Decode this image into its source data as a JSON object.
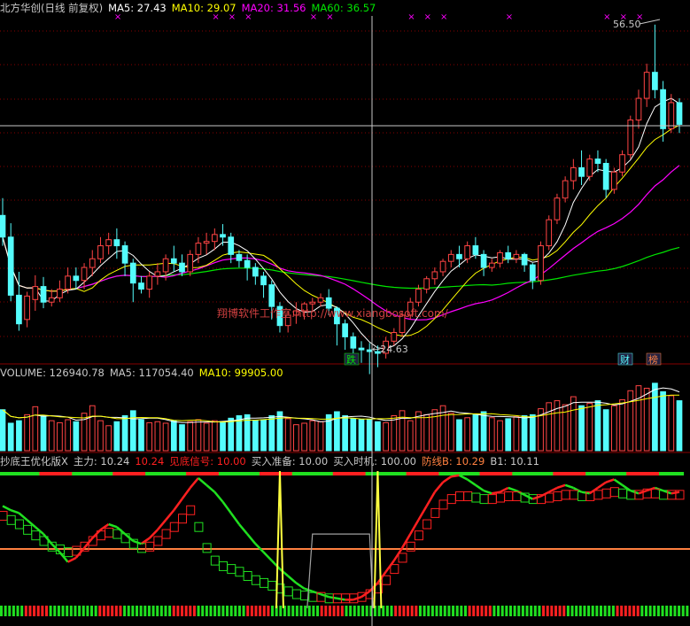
{
  "colors": {
    "bg": "#000000",
    "up": "#ff4444",
    "down": "#54fcfc",
    "ma5": "#ffffff",
    "ma10": "#ffff00",
    "ma20": "#ff00ff",
    "ma60": "#00e600",
    "grid": "#880000",
    "cross": "#c8c8c8",
    "label": "#c8c8c8",
    "ind_red": "#ff2020",
    "ind_green": "#20e020",
    "ind_yellow": "#ffff40",
    "ind_orange": "#ff8040",
    "ind_white": "#c8c8c8",
    "ind_gray": "#a0a0a0"
  },
  "main": {
    "title": "北方华创(日线 前复权)",
    "legend": [
      {
        "label": "MA5: 27.43",
        "color": "#ffffff"
      },
      {
        "label": "MA10: 29.07",
        "color": "#ffff00"
      },
      {
        "label": "MA20: 31.56",
        "color": "#ff00ff"
      },
      {
        "label": "MA60: 36.57",
        "color": "#00e600"
      }
    ],
    "high_label": "56.50",
    "low_label": "24.63",
    "watermark": "翔博软件工作室:http://www.xiangbosoft.com/",
    "badges": [
      {
        "text": "跌",
        "color": "#00e600"
      },
      {
        "text": "财",
        "color": "#54fcfc"
      },
      {
        "text": "榜",
        "color": "#ff8040"
      }
    ],
    "xmarks_note": "magenta x markers along top"
  },
  "volume": {
    "legend": [
      {
        "label": "VOLUME: 126940.78",
        "color": "#c8c8c8"
      },
      {
        "label": "MA5: 117054.40",
        "color": "#c8c8c8"
      },
      {
        "label": "MA10: 99905.00",
        "color": "#ffff00"
      }
    ]
  },
  "indicator": {
    "legend": [
      {
        "label": "抄底王优化版X",
        "color": "#c8c8c8"
      },
      {
        "label": "主力: 10.24",
        "color": "#c8c8c8"
      },
      {
        "label": "10.24",
        "color": "#ff2020"
      },
      {
        "label": "见底信号: 10.00",
        "color": "#ff2020"
      },
      {
        "label": "买入准备: 10.00",
        "color": "#c8c8c8"
      },
      {
        "label": "买入时机: 100.00",
        "color": "#c8c8c8"
      },
      {
        "label": "防线B: 10.29",
        "color": "#ff8040"
      },
      {
        "label": "B1: 10.11",
        "color": "#c8c8c8"
      }
    ]
  },
  "chart_data": {
    "type": "candlestick",
    "title": "北方华创(日线 前复权)",
    "price_range": [
      19.5,
      58.5
    ],
    "candles": [
      [
        35.5,
        37.5,
        33.0,
        32.0
      ],
      [
        33.0,
        34.6,
        26.3,
        25.6
      ],
      [
        26.3,
        29.0,
        23.0,
        22.2
      ],
      [
        23.5,
        26.7,
        26.2,
        22.6
      ],
      [
        25.8,
        28.6,
        27.3,
        24.5
      ],
      [
        27.3,
        28.4,
        25.5,
        24.8
      ],
      [
        25.5,
        27.0,
        26.0,
        25.0
      ],
      [
        26.0,
        28.0,
        27.0,
        25.5
      ],
      [
        27.0,
        29.5,
        28.5,
        26.5
      ],
      [
        28.5,
        29.5,
        28.0,
        27.0
      ],
      [
        28.0,
        30.0,
        29.5,
        27.0
      ],
      [
        29.5,
        31.5,
        30.5,
        28.5
      ],
      [
        30.5,
        33.0,
        32.0,
        30.0
      ],
      [
        32.0,
        33.5,
        32.7,
        31.0
      ],
      [
        32.7,
        34.0,
        32.0,
        30.5
      ],
      [
        32.0,
        32.5,
        30.0,
        28.5
      ],
      [
        30.0,
        30.5,
        27.7,
        25.5
      ],
      [
        27.7,
        28.5,
        27.0,
        26.5
      ],
      [
        27.0,
        29.0,
        28.5,
        26.0
      ],
      [
        28.5,
        30.0,
        29.0,
        27.5
      ],
      [
        29.0,
        31.0,
        30.5,
        28.0
      ],
      [
        30.5,
        32.0,
        30.0,
        29.0
      ],
      [
        30.0,
        31.0,
        29.0,
        28.5
      ],
      [
        29.0,
        31.5,
        31.0,
        28.5
      ],
      [
        31.0,
        33.0,
        32.3,
        30.0
      ],
      [
        32.3,
        33.5,
        32.5,
        31.0
      ],
      [
        32.5,
        34.0,
        33.3,
        31.5
      ],
      [
        33.3,
        34.5,
        33.0,
        32.0
      ],
      [
        33.0,
        33.5,
        31.0,
        30.0
      ],
      [
        31.0,
        31.5,
        30.3,
        29.5
      ],
      [
        30.3,
        31.0,
        29.5,
        28.0
      ],
      [
        29.5,
        30.0,
        28.5,
        27.5
      ],
      [
        28.5,
        29.0,
        27.5,
        26.0
      ],
      [
        27.5,
        28.0,
        25.0,
        23.5
      ],
      [
        25.0,
        25.5,
        22.8,
        22.0
      ],
      [
        22.8,
        24.5,
        24.0,
        22.0
      ],
      [
        24.0,
        25.5,
        24.5,
        23.0
      ],
      [
        24.5,
        25.5,
        25.3,
        23.5
      ],
      [
        25.3,
        26.0,
        25.5,
        24.5
      ],
      [
        25.5,
        26.5,
        26.0,
        25.0
      ],
      [
        26.0,
        27.0,
        24.8,
        24.0
      ],
      [
        24.8,
        25.0,
        23.0,
        20.5
      ],
      [
        23.0,
        23.5,
        21.5,
        20.0
      ],
      [
        21.5,
        22.0,
        20.2,
        19.5
      ],
      [
        20.2,
        21.0,
        20.0,
        18.5
      ],
      [
        20.0,
        20.8,
        19.8,
        17.2
      ],
      [
        19.8,
        20.5,
        19.6,
        18.0
      ],
      [
        19.6,
        21.5,
        21.0,
        19.0
      ],
      [
        21.0,
        22.5,
        22.0,
        20.5
      ],
      [
        22.0,
        24.5,
        24.0,
        21.5
      ],
      [
        24.0,
        26.0,
        25.5,
        23.5
      ],
      [
        25.5,
        27.5,
        27.0,
        25.0
      ],
      [
        27.0,
        28.5,
        28.2,
        26.5
      ],
      [
        28.2,
        29.5,
        29.0,
        27.5
      ],
      [
        29.0,
        30.5,
        30.2,
        28.5
      ],
      [
        30.2,
        31.5,
        31.0,
        29.5
      ],
      [
        31.0,
        32.0,
        30.5,
        29.5
      ],
      [
        30.5,
        32.5,
        32.0,
        30.0
      ],
      [
        32.0,
        33.0,
        31.0,
        30.5
      ],
      [
        31.0,
        31.5,
        29.5,
        28.5
      ],
      [
        29.5,
        30.5,
        30.0,
        29.0
      ],
      [
        30.0,
        31.5,
        31.2,
        29.5
      ],
      [
        31.2,
        32.0,
        30.5,
        30.0
      ],
      [
        30.5,
        31.5,
        31.0,
        30.0
      ],
      [
        31.0,
        31.2,
        29.8,
        29.0
      ],
      [
        29.8,
        30.0,
        28.0,
        27.0
      ],
      [
        28.0,
        32.5,
        32.0,
        27.5
      ],
      [
        32.0,
        35.5,
        35.0,
        31.5
      ],
      [
        35.0,
        38.0,
        37.5,
        34.5
      ],
      [
        37.5,
        40.0,
        39.5,
        37.0
      ],
      [
        39.5,
        42.0,
        41.0,
        38.5
      ],
      [
        41.0,
        43.0,
        40.0,
        39.0
      ],
      [
        40.0,
        42.5,
        42.0,
        39.5
      ],
      [
        42.0,
        43.0,
        41.5,
        40.5
      ],
      [
        41.5,
        42.0,
        38.5,
        37.5
      ],
      [
        38.5,
        41.0,
        40.5,
        38.0
      ],
      [
        40.5,
        43.0,
        42.5,
        40.0
      ],
      [
        42.5,
        47.0,
        46.5,
        42.0
      ],
      [
        46.5,
        50.0,
        49.0,
        45.5
      ],
      [
        49.0,
        53.0,
        52.0,
        48.0
      ],
      [
        52.0,
        57.5,
        50.0,
        49.0
      ],
      [
        50.0,
        51.0,
        45.5,
        44.0
      ],
      [
        45.5,
        49.5,
        48.5,
        45.0
      ],
      [
        48.5,
        49.0,
        46.0,
        45.0
      ]
    ],
    "volume": [
      82,
      55,
      60,
      72,
      88,
      70,
      60,
      56,
      62,
      58,
      75,
      90,
      60,
      50,
      58,
      70,
      80,
      62,
      56,
      58,
      55,
      60,
      52,
      58,
      62,
      55,
      60,
      58,
      65,
      70,
      72,
      60,
      62,
      70,
      78,
      64,
      52,
      55,
      60,
      58,
      72,
      78,
      70,
      64,
      62,
      62,
      58,
      56,
      70,
      80,
      60,
      78,
      72,
      82,
      90,
      75,
      62,
      66,
      72,
      78,
      66,
      60,
      64,
      68,
      70,
      72,
      84,
      96,
      100,
      92,
      108,
      90,
      95,
      100,
      82,
      90,
      102,
      120,
      130,
      125,
      135,
      118,
      110,
      100
    ]
  }
}
